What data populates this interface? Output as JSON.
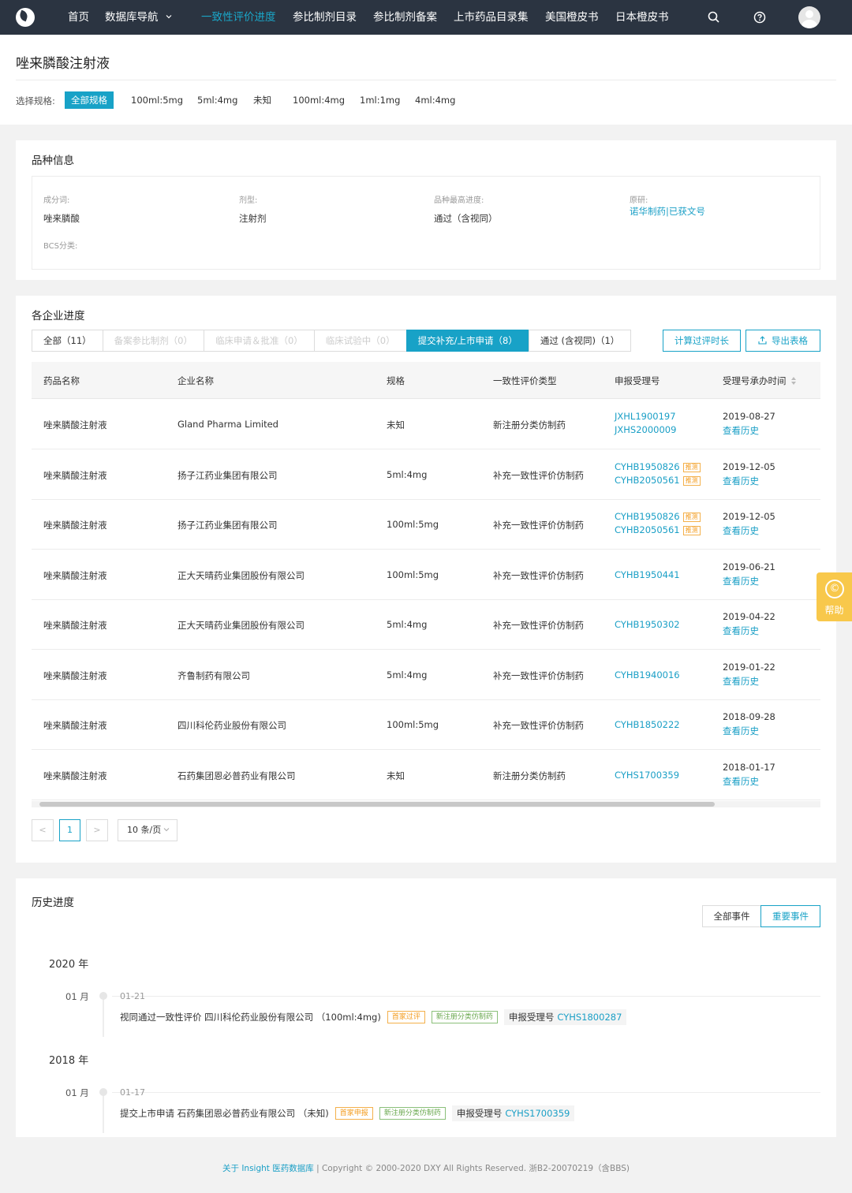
{
  "nav": {
    "items": [
      {
        "label": "首页"
      },
      {
        "label": "数据库导航"
      },
      {
        "label": "一致性评价进度"
      },
      {
        "label": "参比制剂目录"
      },
      {
        "label": "参比制剂备案"
      },
      {
        "label": "上市药品目录集"
      },
      {
        "label": "美国橙皮书"
      },
      {
        "label": "日本橙皮书"
      }
    ]
  },
  "header": {
    "title": "唑来膦酸注射液",
    "spec_label": "选择规格:",
    "specs": [
      "全部规格",
      "100ml:5mg",
      "5ml:4mg",
      "未知",
      "100ml:4mg",
      "1ml:1mg",
      "4ml:4mg"
    ]
  },
  "variety": {
    "title": "品种信息",
    "fields": [
      {
        "key": "成分词:",
        "value": "唑来膦酸"
      },
      {
        "key": "剂型:",
        "value": "注射剂"
      },
      {
        "key": "品种最高进度:",
        "value": "通过（含视同）"
      },
      {
        "key": "原研:",
        "value": "诺华制药|已获文号"
      },
      {
        "key": "BCS分类:",
        "value": ""
      }
    ]
  },
  "progress": {
    "title": "各企业进度",
    "tabs": [
      "全部（11）",
      "备案参比制剂（0）",
      "临床申请＆批准（0）",
      "临床试验中（0）",
      "提交补充/上市申请（8）",
      "通过 (含视同)（1）"
    ],
    "calc_button": "计算过评时长",
    "export_button": "导出表格",
    "columns": [
      "药品名称",
      "企业名称",
      "规格",
      "一致性评价类型",
      "申报受理号",
      "受理号承办时间"
    ],
    "rows": [
      {
        "drug": "唑来膦酸注射液",
        "company": "Gland Pharma Limited",
        "spec": "未知",
        "type": "新注册分类仿制药",
        "nums": [
          "JXHL1900197",
          "JXHS2000009"
        ],
        "badges": [
          "",
          ""
        ],
        "date": "2019-08-27",
        "history": "查看历史"
      },
      {
        "drug": "唑来膦酸注射液",
        "company": "扬子江药业集团有限公司",
        "spec": "5ml:4mg",
        "type": "补充一致性评价仿制药",
        "nums": [
          "CYHB1950826",
          "CYHB2050561"
        ],
        "badges": [
          "推测",
          "推测"
        ],
        "date": "2019-12-05",
        "history": "查看历史"
      },
      {
        "drug": "唑来膦酸注射液",
        "company": "扬子江药业集团有限公司",
        "spec": "100ml:5mg",
        "type": "补充一致性评价仿制药",
        "nums": [
          "CYHB1950826",
          "CYHB2050561"
        ],
        "badges": [
          "推测",
          "推测"
        ],
        "date": "2019-12-05",
        "history": "查看历史"
      },
      {
        "drug": "唑来膦酸注射液",
        "company": "正大天晴药业集团股份有限公司",
        "spec": "100ml:5mg",
        "type": "补充一致性评价仿制药",
        "nums": [
          "CYHB1950441"
        ],
        "badges": [
          ""
        ],
        "date": "2019-06-21",
        "history": "查看历史"
      },
      {
        "drug": "唑来膦酸注射液",
        "company": "正大天晴药业集团股份有限公司",
        "spec": "5ml:4mg",
        "type": "补充一致性评价仿制药",
        "nums": [
          "CYHB1950302"
        ],
        "badges": [
          ""
        ],
        "date": "2019-04-22",
        "history": "查看历史"
      },
      {
        "drug": "唑来膦酸注射液",
        "company": "齐鲁制药有限公司",
        "spec": "5ml:4mg",
        "type": "补充一致性评价仿制药",
        "nums": [
          "CYHB1940016"
        ],
        "badges": [
          ""
        ],
        "date": "2019-01-22",
        "history": "查看历史"
      },
      {
        "drug": "唑来膦酸注射液",
        "company": "四川科伦药业股份有限公司",
        "spec": "100ml:5mg",
        "type": "补充一致性评价仿制药",
        "nums": [
          "CYHB1850222"
        ],
        "badges": [
          ""
        ],
        "date": "2018-09-28",
        "history": "查看历史"
      },
      {
        "drug": "唑来膦酸注射液",
        "company": "石药集团恩必普药业有限公司",
        "spec": "未知",
        "type": "新注册分类仿制药",
        "nums": [
          "CYHS1700359"
        ],
        "badges": [
          ""
        ],
        "date": "2018-01-17",
        "history": "查看历史"
      }
    ],
    "pagination": {
      "prev": "<",
      "current": "1",
      "next": ">",
      "page_size": "10 条/页"
    }
  },
  "history": {
    "title": "历史进度",
    "all_button": "全部事件",
    "important_button": "重要事件",
    "years": [
      {
        "year": "2020 年",
        "month": "01 月",
        "date": "01-21",
        "text": "视同通过一致性评价 四川科伦药业股份有限公司 （100ml:4mg)",
        "tags": [
          "首家过评",
          "新注册分类仿制药"
        ],
        "reg_label": "申报受理号",
        "reg_no": "CYHS1800287"
      },
      {
        "year": "2018 年",
        "month": "01 月",
        "date": "01-17",
        "text": "提交上市申请 石药集团恩必普药业有限公司 （未知)",
        "tags": [
          "首家申报",
          "新注册分类仿制药"
        ],
        "reg_label": "申报受理号",
        "reg_no": "CYHS1700359"
      }
    ]
  },
  "help": {
    "label": "帮助"
  },
  "footer": {
    "link": "关于 Insight 医药数据库",
    "copyright": "| Copyright © 2000-2020 DXY All Rights Reserved. 浙B2-20070219（含BBS)"
  },
  "colors": {
    "accent": "#18a2c7",
    "nav_bg": "#2b3441",
    "warning": "#f39a1a",
    "success": "#6aa84f",
    "help_bg": "#f8c84b"
  },
  "icons": [
    "logo-icon",
    "search-icon",
    "help-circle-icon",
    "avatar",
    "chevron-down-icon",
    "export-icon",
    "sort-icon",
    "help-widget-icon"
  ]
}
